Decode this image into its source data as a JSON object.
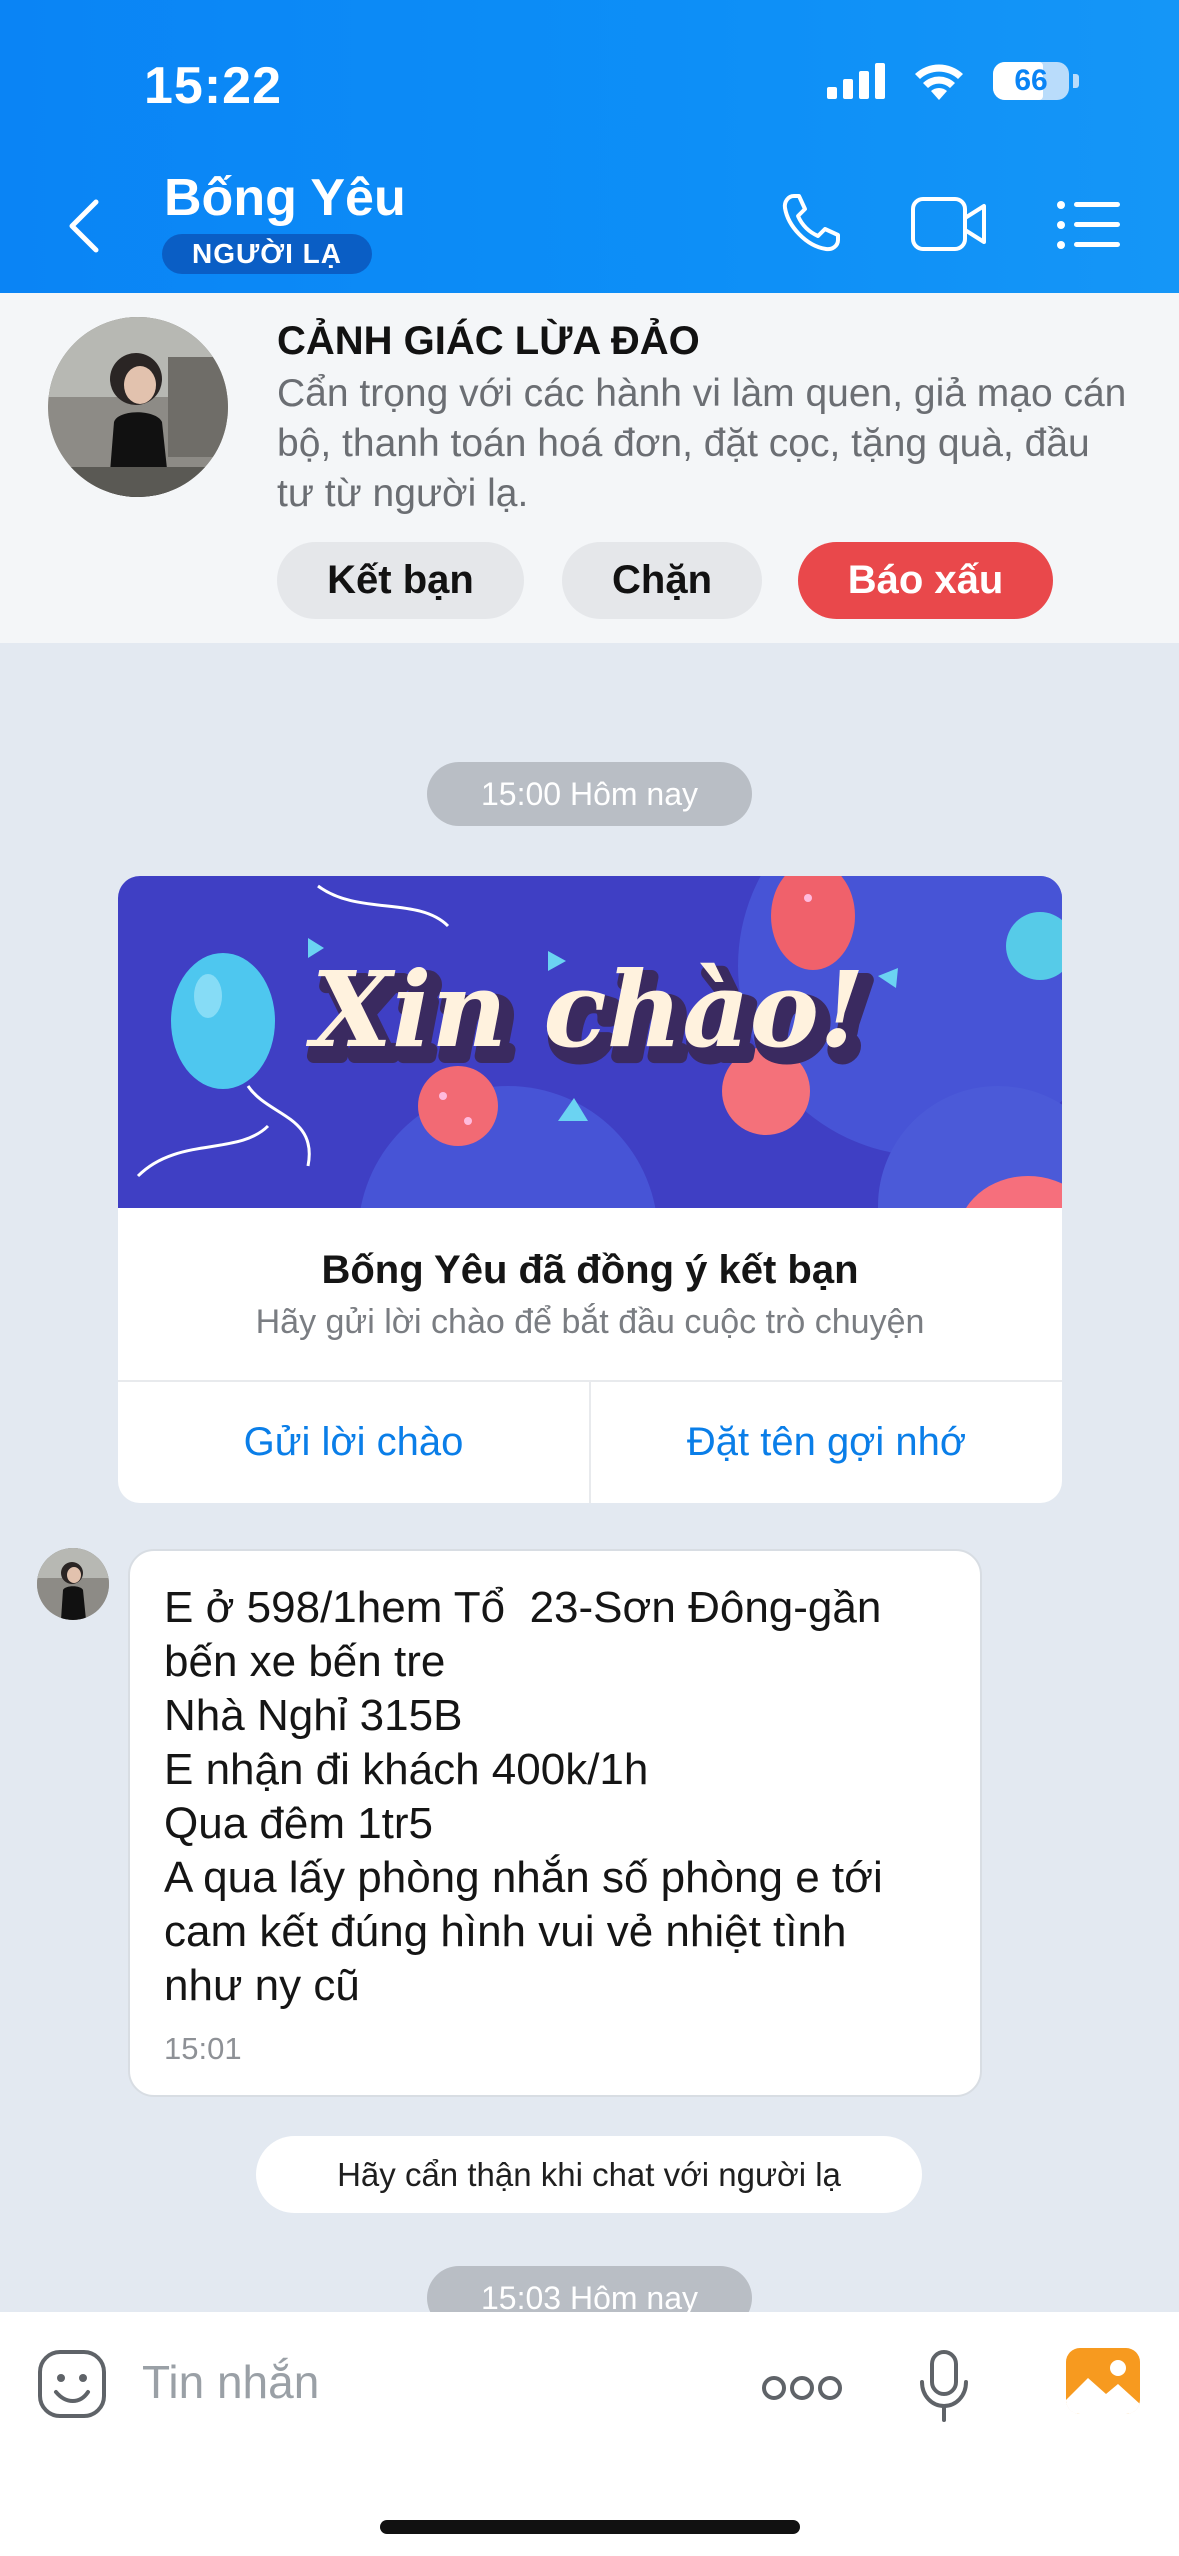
{
  "status_bar": {
    "time": "15:22",
    "battery": "66"
  },
  "header": {
    "contact_name": "Bống Yêu",
    "badge": "NGƯỜI LẠ",
    "icons": [
      "back-icon",
      "phone-icon",
      "video-call-icon",
      "menu-list-icon"
    ]
  },
  "warning": {
    "title": "CẢNH GIÁC LỪA ĐẢO",
    "text": "Cẩn trọng với các hành vi làm quen, giả mạo cán bộ, thanh toán hoá đơn, đặt cọc, tặng quà, đầu tư từ người lạ.",
    "add_friend": "Kết bạn",
    "block": "Chặn",
    "report": "Báo xấu"
  },
  "chat": {
    "time_1": "15:00 Hôm nay",
    "card": {
      "banner_text": "Xin chào!",
      "title": "Bống Yêu đã đồng ý kết bạn",
      "subtitle": "Hãy gửi lời chào để bắt đầu cuộc trò chuyện",
      "send_greeting": "Gửi lời chào",
      "set_nickname": "Đặt tên gợi nhớ"
    },
    "message": {
      "lines": [
        "E ở 598/1hem Tổ  23-Sơn Đông-gần",
        "bến xe bến tre",
        "Nhà Nghỉ 315B",
        "E nhận đi khách 400k/1h",
        "Qua đêm 1tr5",
        "A qua lấy phòng nhắn số phòng e tới",
        "cam kết đúng hình vui vẻ nhiệt tình",
        "như ny cũ"
      ],
      "time": "15:01"
    },
    "notice": "Hãy cẩn thận khi chat với người lạ",
    "time_2": "15:03 Hôm nay"
  },
  "input": {
    "placeholder": "Tin nhắn",
    "icons": [
      "sticker-icon",
      "more-icon",
      "microphone-icon",
      "image-icon"
    ]
  },
  "colors": {
    "primary": "#0a84f5",
    "report": "#e9484b",
    "chat_bg": "#e3e9f1"
  }
}
